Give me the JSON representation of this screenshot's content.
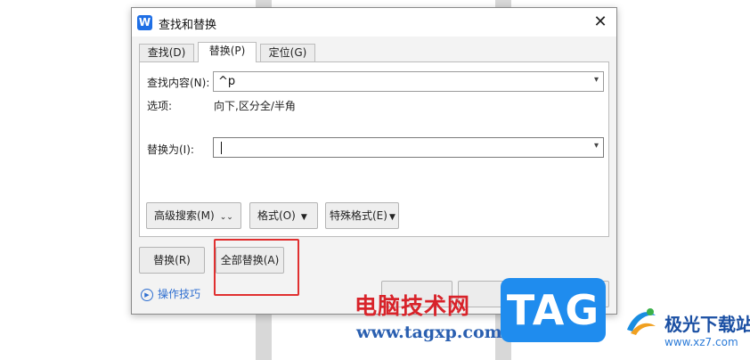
{
  "dialog": {
    "title": "查找和替换",
    "app_icon": "W",
    "close_symbol": "✕"
  },
  "tabs": [
    {
      "label": "查找(D)",
      "active": false
    },
    {
      "label": "替换(P)",
      "active": true
    },
    {
      "label": "定位(G)",
      "active": false
    }
  ],
  "find": {
    "label": "查找内容(N):",
    "value": "^p"
  },
  "options": {
    "label": "选项:",
    "value": "向下,区分全/半角"
  },
  "replace": {
    "label": "替换为(I):",
    "value": ""
  },
  "format_buttons": {
    "advanced_search": "高级搜索(M)",
    "format": "格式(O)",
    "special_format": "特殊格式(E)"
  },
  "actions": {
    "replace": "替换(R)",
    "replace_all": "全部替换(A)"
  },
  "tips": {
    "label": "操作技巧"
  },
  "watermarks": {
    "site_cn": "电脑技术网",
    "site_url": "www.tagxp.com",
    "tag_logo": "TAG",
    "xz_name": "极光下载站",
    "xz_url": "www.xz7.com"
  },
  "colors": {
    "accent": "#1f6fe5",
    "highlight_box": "#e03030",
    "watermark_red": "#d8232a",
    "watermark_blue": "#1f8cee"
  }
}
